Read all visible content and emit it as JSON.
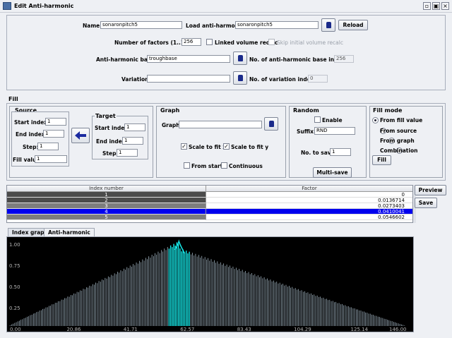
{
  "window": {
    "title": "Edit Anti-harmonic"
  },
  "top": {
    "name_label": "Name:",
    "name_value": "sonaronpitch5",
    "load_label": "Load anti-harmonic:",
    "load_value": "sonaronpitch5",
    "reload_label": "Reload",
    "factors_label": "Number of factors (1..1024):",
    "factors_value": "256",
    "linked_label": "Linked volume recalc",
    "skip_label": "Skip initial volume recalc",
    "base_label": "Anti-harmonic base:",
    "base_value": "troughbase",
    "base_indexes_label": "No. of anti-harmonic base indexes:",
    "base_indexes_value": "256",
    "variation_label": "Variation:",
    "variation_value": "",
    "variation_indexes_label": "No. of variation indexes:",
    "variation_indexes_value": "0"
  },
  "fill": {
    "title": "Fill",
    "source": {
      "title": "Source",
      "start_label": "Start index:",
      "start_value": "1",
      "end_label": "End index:",
      "end_value": "1",
      "step_label": "Step:",
      "step_value": "1",
      "fill_label": "Fill value:",
      "fill_value": "1"
    },
    "target": {
      "title": "Target",
      "start_label": "Start index:",
      "start_value": "1",
      "end_label": "End index:",
      "end_value": "1",
      "step_label": "Step:",
      "step_value": "1"
    },
    "graph": {
      "title": "Graph",
      "graph_label": "Graph:",
      "graph_value": "",
      "scale_x": "Scale to fit x",
      "scale_y": "Scale to fit y",
      "from_start": "From start",
      "continuous": "Continuous"
    },
    "random": {
      "title": "Random",
      "enable_label": "Enable",
      "suffix_label": "Suffix:",
      "suffix_value": "RND",
      "nosave_label": "No. to save:",
      "nosave_value": "1",
      "multisave_label": "Multi-save"
    },
    "mode": {
      "title": "Fill mode",
      "opt1": "From fill value",
      "opt2": "From source",
      "opt3": "From graph",
      "opt4": "Combination",
      "fill_button": "Fill"
    }
  },
  "table": {
    "col1": "Index number",
    "col2": "Factor",
    "rows": [
      {
        "index": "1",
        "factor": "0"
      },
      {
        "index": "2",
        "factor": "0.0136714"
      },
      {
        "index": "3",
        "factor": "0.0273403"
      },
      {
        "index": "4",
        "factor": "0.0410041"
      },
      {
        "index": "5",
        "factor": "0.0546602"
      }
    ]
  },
  "side": {
    "preview_label": "Preview",
    "save_label": "Save"
  },
  "tabs": {
    "index_graph": "Index graph",
    "anti_harmonic": "Anti-harmonic"
  },
  "chart_data": {
    "type": "bar",
    "x_ticks": [
      "0.00",
      "20.86",
      "41.71",
      "62.57",
      "83.43",
      "104.29",
      "125.14",
      "146.00"
    ],
    "y_ticks": [
      "0.25",
      "0.50",
      "0.75",
      "1.00"
    ],
    "xlim": [
      0,
      146
    ],
    "ylim": [
      0,
      1
    ],
    "peak_x": 62.57,
    "peak_y": 1.0,
    "colors": {
      "bars": "#b8cddc",
      "peak": "#16e8e8",
      "background": "#000000",
      "axis_text": "#b4b4b4"
    }
  },
  "colors": {
    "selected_row": "#0000ee",
    "dark_row": "#4b4b4b",
    "mid_row": "#7d7d7d"
  }
}
